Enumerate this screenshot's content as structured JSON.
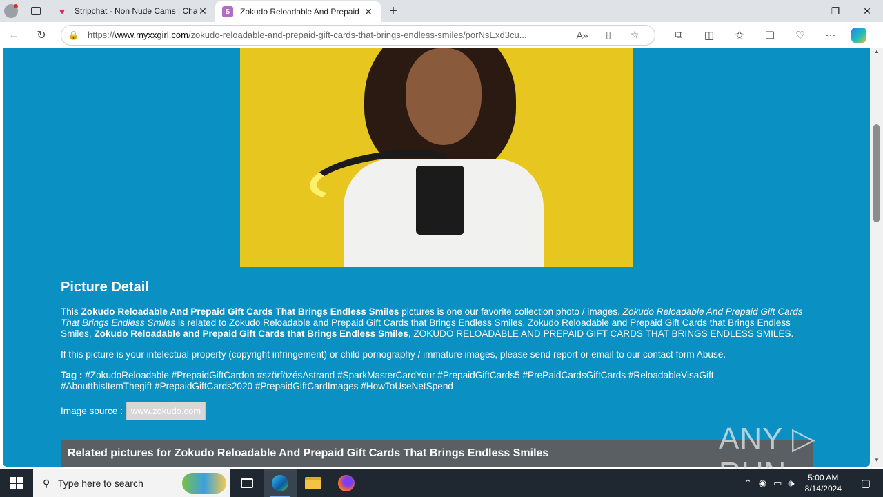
{
  "browser": {
    "tabs": [
      {
        "title": "Stripchat - Non Nude Cams | Cha",
        "icon": "heart-icon"
      },
      {
        "title": "Zokudo Reloadable And Prepaid",
        "icon": "s-favicon"
      }
    ],
    "url_prefix": "https://",
    "url_domain": "www.myxxgirl.com",
    "url_path": "/zokudo-reloadable-and-prepaid-gift-cards-that-brings-endless-smiles/porNsExd3cu..."
  },
  "page": {
    "detail_heading": "Picture Detail",
    "p1": {
      "a": "This ",
      "b": "Zokudo Reloadable And Prepaid Gift Cards That Brings Endless Smiles",
      "c": " pictures is one our favorite collection photo / images. ",
      "d": "Zokudo Reloadable And Prepaid Gift Cards That Brings Endless Smiles",
      "e": " is related to Zokudo Reloadable and Prepaid Gift Cards that Brings Endless Smiles, Zokudo Reloadable and Prepaid Gift Cards that Brings Endless Smiles, ",
      "f": "Zokudo Reloadable and Prepaid Gift Cards that Brings Endless Smiles",
      "g": ", ZOKUDO RELOADABLE AND PREPAID GIFT CARDS THAT BRINGS ENDLESS SMILES."
    },
    "p2": "If this picture is your intelectual property (copyright infringement) or child pornography / immature images, please send report or email to our contact form Abuse.",
    "tag_label": "Tag :",
    "tags": " #ZokudoReloadable #PrepaidGiftCardon #szörfözésAstrand #SparkMasterCardYour #PrepaidGiftCards5 #PrePaidCardsGiftCards #ReloadableVisaGift #AboutthisItemThegift #PrepaidGiftCards2020 #PrepaidGiftCardImages #HowToUseNetSpend",
    "source_label": "Image source :",
    "source_link": "www.zokudo.com",
    "related_heading": "Related pictures for Zokudo Reloadable And Prepaid Gift Cards That Brings Endless Smiles",
    "watermark": "ANY ▷ RUN"
  },
  "taskbar": {
    "search_placeholder": "Type here to search",
    "time": "5:00 AM",
    "date": "8/14/2024"
  },
  "colors": {
    "page_bg": "#0a90c2",
    "hero_bg": "#e8c620",
    "related_bar": "#5a5f63"
  }
}
